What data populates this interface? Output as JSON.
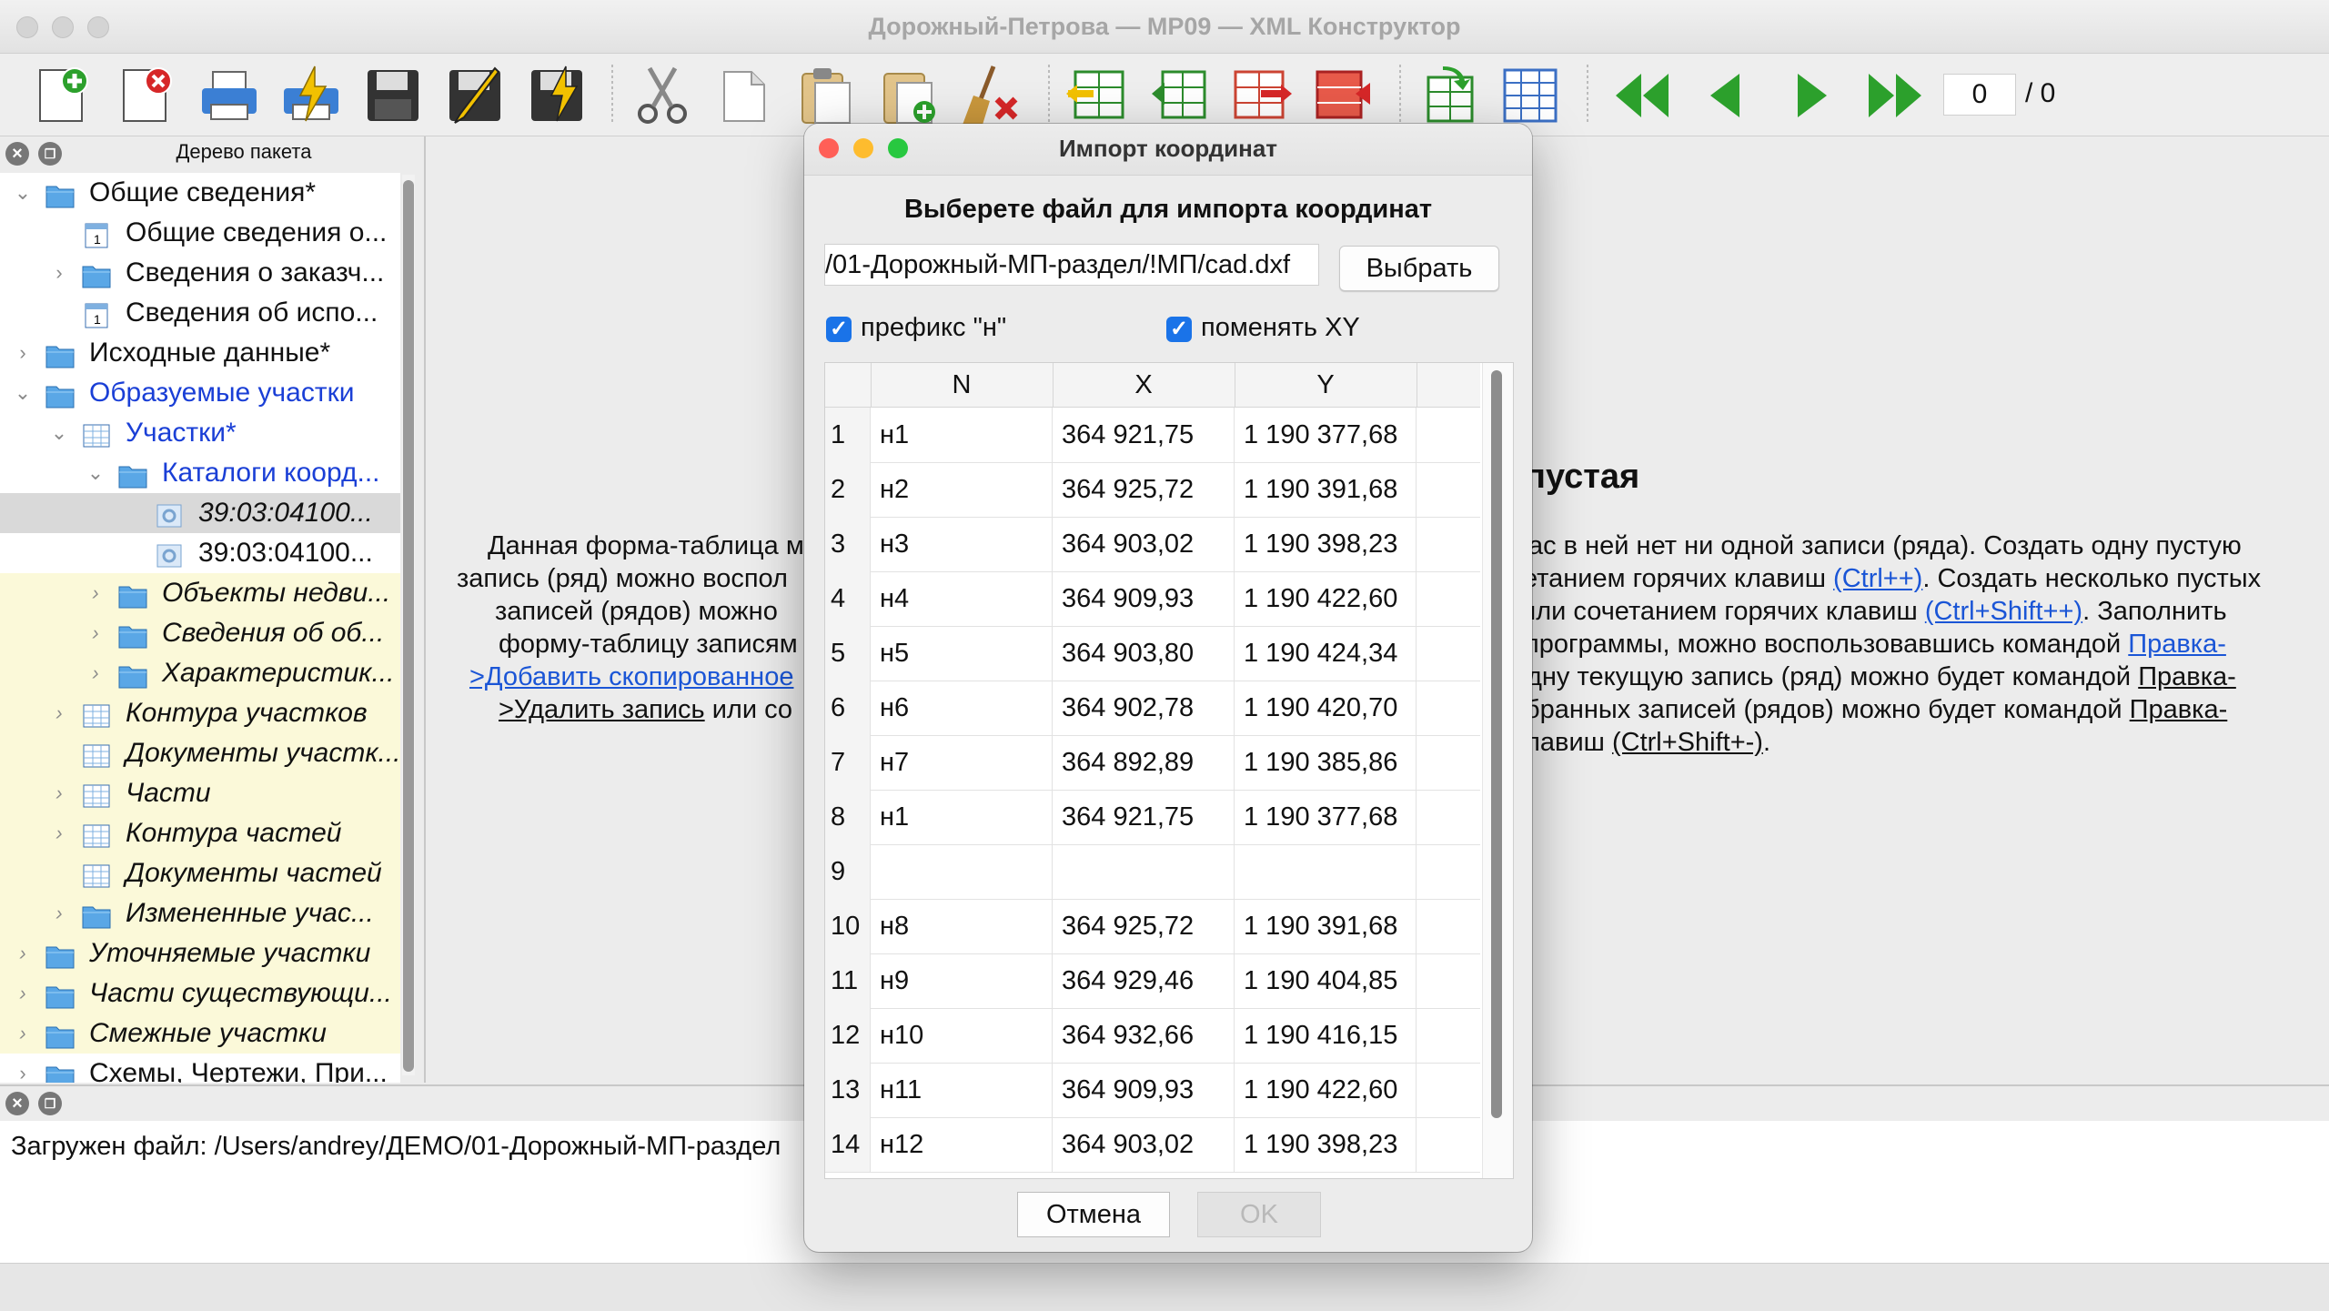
{
  "window": {
    "title": "Дорожный-Петрова — MP09 — XML Конструктор"
  },
  "toolbar": {
    "record_current": "0",
    "record_total": "/ 0"
  },
  "tree": {
    "title": "Дерево пакета",
    "items": [
      {
        "label": "Общие сведения*"
      },
      {
        "label": "Общие сведения о..."
      },
      {
        "label": "Сведения о заказч..."
      },
      {
        "label": "Сведения об испо..."
      },
      {
        "label": "Исходные данные*"
      },
      {
        "label": "Образуемые участки"
      },
      {
        "label": "Участки*"
      },
      {
        "label": "Каталоги коорд..."
      },
      {
        "label": "39:03:04100..."
      },
      {
        "label": "39:03:04100..."
      },
      {
        "label": "Объекты недви..."
      },
      {
        "label": "Сведения об об..."
      },
      {
        "label": "Характеристик..."
      },
      {
        "label": "Контура участков"
      },
      {
        "label": "Документы участк..."
      },
      {
        "label": "Части"
      },
      {
        "label": "Контура частей"
      },
      {
        "label": "Документы частей"
      },
      {
        "label": "Измененные учас..."
      },
      {
        "label": "Уточняемые участки"
      },
      {
        "label": "Части существующи..."
      },
      {
        "label": "Смежные участки"
      },
      {
        "label": "Схемы, Чертежи, При..."
      }
    ]
  },
  "content": {
    "heading_fragment": "пустая",
    "left_lines": [
      "Данная форма-таблица м",
      "запись (ряд) можно воспол",
      "записей (рядов) можно",
      "форму-таблицу записям",
      ">Добавить скопированное",
      ">Удалить запись",
      "или со"
    ],
    "right_lines": [
      "ас в ней нет ни одной записи (ряда). Создать одну пустую",
      "етанием горячих клавиш",
      "(Ctrl++)",
      ". Создать несколько пустых",
      "или сочетанием горячих клавиш",
      "(Ctrl+Shift++)",
      ". Заполнить",
      "программы, можно воспользовавшись командой",
      "Правка-",
      "дну текущую запись (ряд) можно будет командой",
      "Правка-",
      "бранных записей (рядов) можно будет командой",
      "Правка-",
      "лавиш",
      "(Ctrl+Shift+-)",
      "."
    ]
  },
  "log": {
    "text": "Загружен файл: /Users/andrey/ДЕМО/01-Дорожный-МП-раздел"
  },
  "dialog": {
    "title": "Импорт координат",
    "heading": "Выберете файл для импорта координат",
    "file_path": "/01-Дорожный-МП-раздел/!МП/cad.dxf",
    "choose_label": "Выбрать",
    "prefix_label": "префикс \"н\"",
    "prefix_checked": true,
    "swap_label": "поменять XY",
    "swap_checked": true,
    "columns": [
      "N",
      "X",
      "Y"
    ],
    "rows": [
      {
        "idx": "1",
        "n": "н1",
        "x": "364 921,75",
        "y": "1 190 377,68"
      },
      {
        "idx": "2",
        "n": "н2",
        "x": "364 925,72",
        "y": "1 190 391,68"
      },
      {
        "idx": "3",
        "n": "н3",
        "x": "364 903,02",
        "y": "1 190 398,23"
      },
      {
        "idx": "4",
        "n": "н4",
        "x": "364 909,93",
        "y": "1 190 422,60"
      },
      {
        "idx": "5",
        "n": "н5",
        "x": "364 903,80",
        "y": "1 190 424,34"
      },
      {
        "idx": "6",
        "n": "н6",
        "x": "364 902,78",
        "y": "1 190 420,70"
      },
      {
        "idx": "7",
        "n": "н7",
        "x": "364 892,89",
        "y": "1 190 385,86"
      },
      {
        "idx": "8",
        "n": "н1",
        "x": "364 921,75",
        "y": "1 190 377,68"
      },
      {
        "idx": "9",
        "n": "",
        "x": "",
        "y": ""
      },
      {
        "idx": "10",
        "n": "н8",
        "x": "364 925,72",
        "y": "1 190 391,68"
      },
      {
        "idx": "11",
        "n": "н9",
        "x": "364 929,46",
        "y": "1 190 404,85"
      },
      {
        "idx": "12",
        "n": "н10",
        "x": "364 932,66",
        "y": "1 190 416,15"
      },
      {
        "idx": "13",
        "n": "н11",
        "x": "364 909,93",
        "y": "1 190 422,60"
      },
      {
        "idx": "14",
        "n": "н12",
        "x": "364 903,02",
        "y": "1 190 398,23"
      }
    ],
    "cancel_label": "Отмена",
    "ok_label": "OK",
    "colors": {
      "close": "#ff5f57",
      "minimize": "#febc2e",
      "zoom": "#28c840",
      "checkbox": "#1a73e8"
    }
  }
}
